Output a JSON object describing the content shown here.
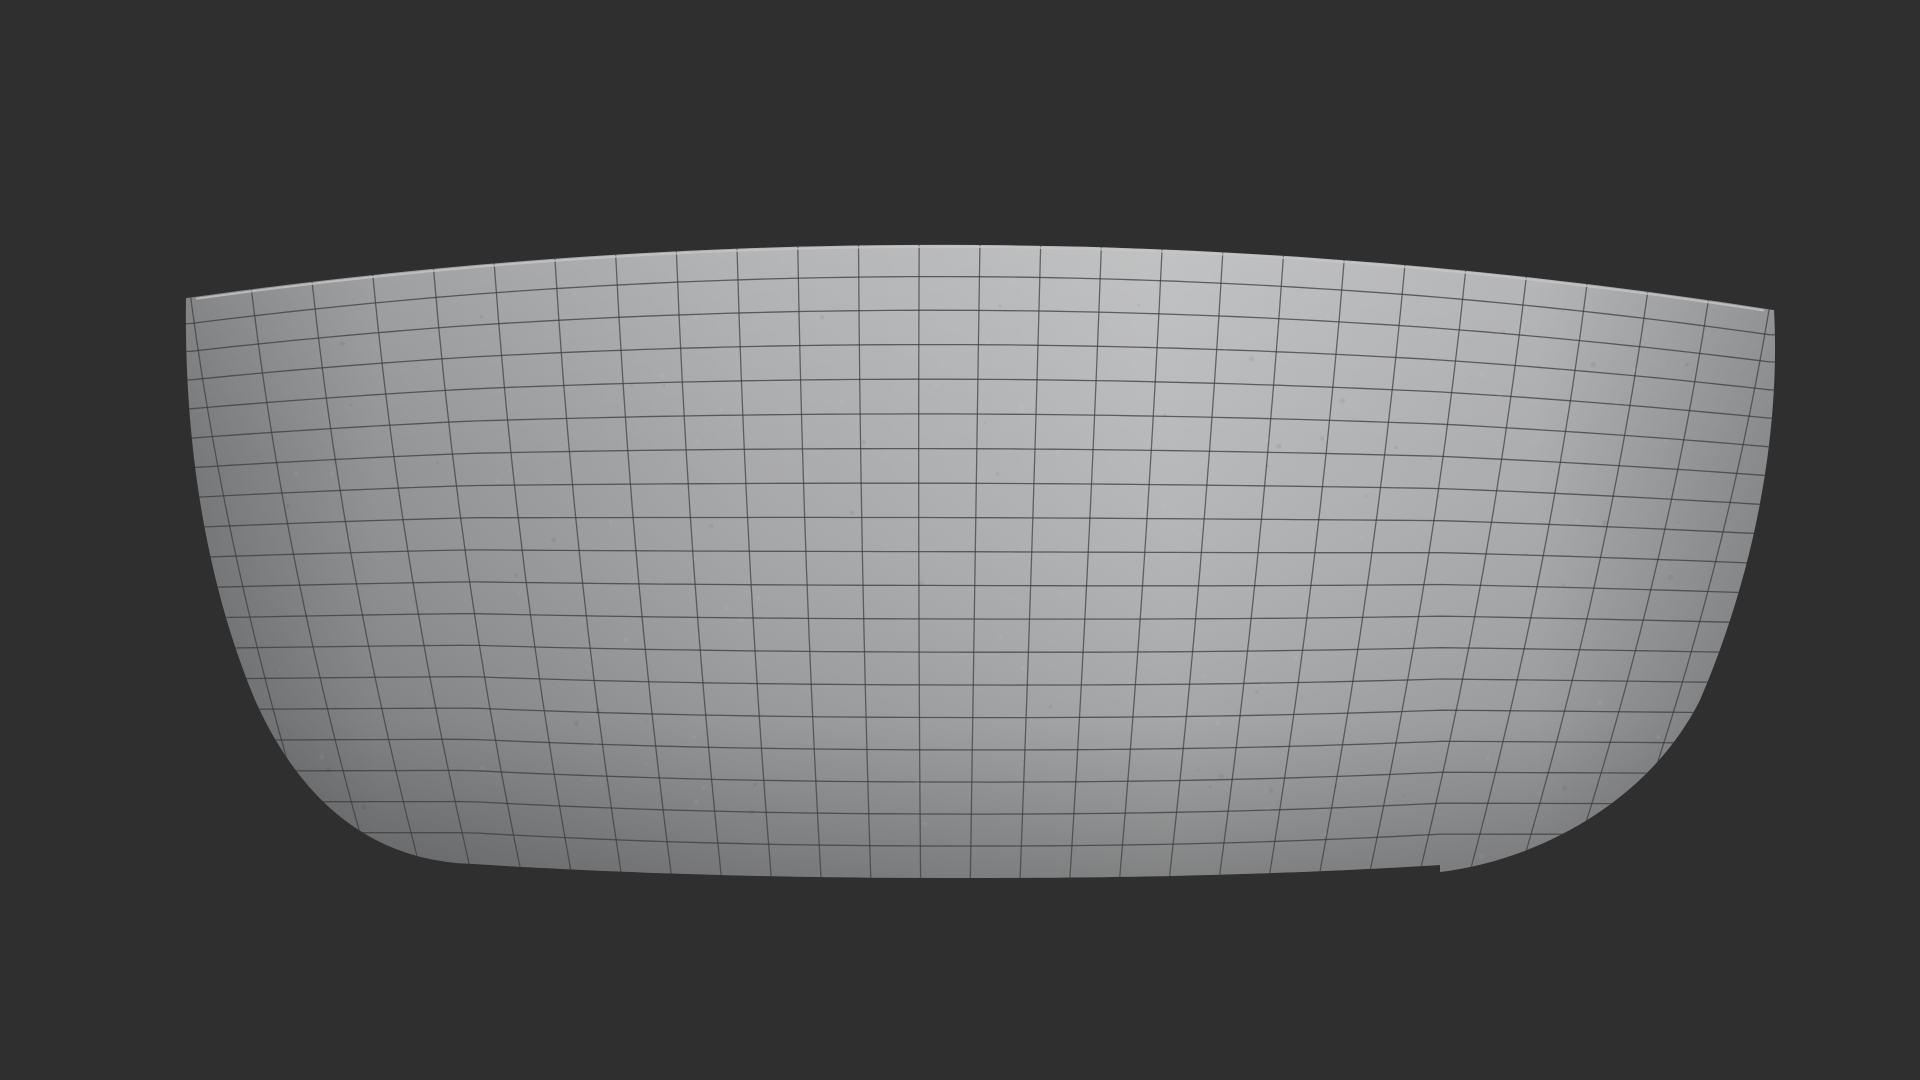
{
  "viewport": {
    "background_color": "#2f2f2f",
    "model": {
      "name": "bowl-wireframe-mesh",
      "surface_color": "#a9aaab",
      "highlight_color": "#d6d6d6",
      "shadow_color": "#6f7072",
      "wire_color": "#3b3c3e",
      "shading": "matcap-clay",
      "wireframe_overlay": true
    }
  }
}
